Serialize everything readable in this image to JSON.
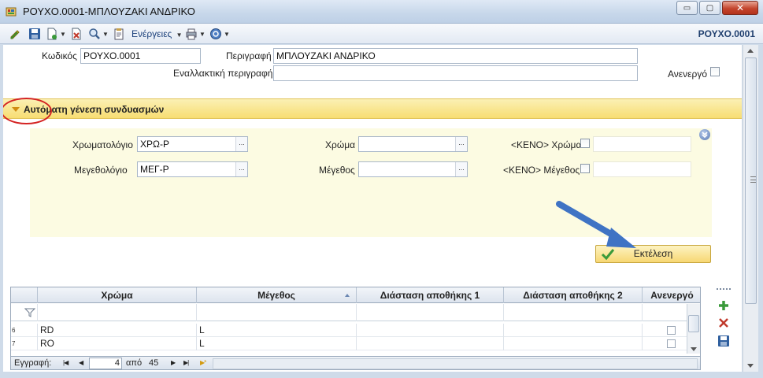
{
  "window": {
    "title": "ΡΟΥΧΟ.0001-ΜΠΛΟΥΖΑΚΙ ΑΝΔΡΙΚΟ",
    "minimize_glyph": "▭",
    "maximize_glyph": "▢",
    "close_glyph": "✕"
  },
  "toolbar": {
    "actions_label": "Ενέργειες",
    "record_code": "ΡΟΥΧΟ.0001",
    "icons": [
      "edit-icon",
      "save-icon",
      "new-document-icon",
      "delete-icon",
      "search-icon",
      "notes-icon",
      "print-icon",
      "help-icon"
    ]
  },
  "form": {
    "code_label": "Κωδικός",
    "code_value": "ΡΟΥΧΟ.0001",
    "description_label": "Περιγραφή",
    "description_value": "ΜΠΛΟΥΖΑΚΙ ΑΝΔΡΙΚΟ",
    "alt_description_label": "Εναλλακτική περιγραφή",
    "alt_description_value": "",
    "inactive_label": "Ανενεργό",
    "inactive_checked": false
  },
  "generation": {
    "section_title": "Αυτόματη γένεση συνδυασμών",
    "color_chart_label": "Χρωματολόγιο",
    "color_chart_value": "ΧΡΩ-Ρ",
    "size_chart_label": "Μεγεθολόγιο",
    "size_chart_value": "ΜΕΓ-Ρ",
    "color_label": "Χρώμα",
    "color_value": "",
    "size_label": "Μέγεθος",
    "size_value": "",
    "empty_color_label": "<ΚΕΝΟ> Χρώμα",
    "empty_size_label": "<ΚΕΝΟ> Μέγεθος",
    "picker_glyph": "...",
    "run_button_label": "Εκτέλεση"
  },
  "grid": {
    "columns": [
      "Χρώμα",
      "Μέγεθος",
      "Διάσταση αποθήκης 1",
      "Διάσταση αποθήκης 2",
      "Ανενεργό"
    ],
    "rows": [
      {
        "num": "6",
        "color": "RD",
        "size": "L",
        "inactive": false
      },
      {
        "num": "7",
        "color": "RO",
        "size": "L",
        "inactive": false
      }
    ],
    "nav": {
      "record_label": "Εγγραφή:",
      "current": "4",
      "of_label": "από",
      "total": "45"
    }
  },
  "colors": {
    "accent_yellow": "#f7dd72",
    "group_body": "#fcfbe2",
    "annotation_red": "#d42323",
    "annotation_arrow": "#3f73c4"
  }
}
